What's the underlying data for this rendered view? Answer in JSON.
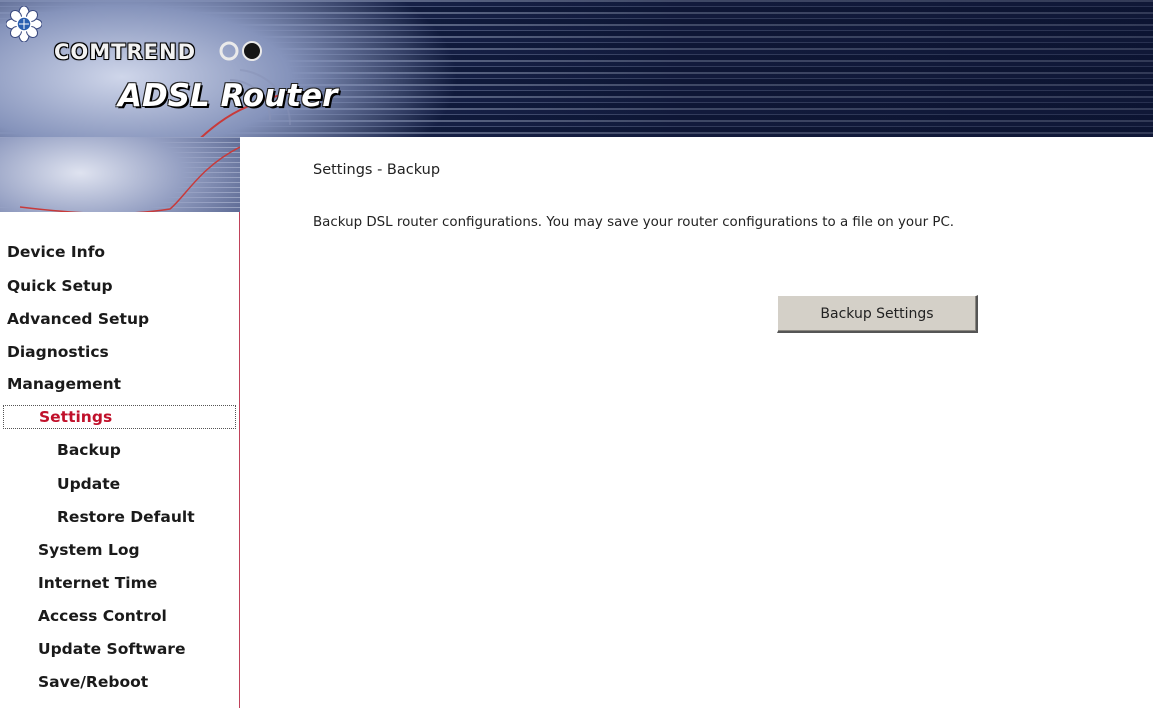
{
  "header": {
    "brand": "COMTREND",
    "product": "ADSL Router"
  },
  "sidebar": {
    "items": [
      {
        "label": "Device Info"
      },
      {
        "label": "Quick Setup"
      },
      {
        "label": "Advanced Setup"
      },
      {
        "label": "Diagnostics"
      },
      {
        "label": "Management"
      },
      {
        "label": "Settings",
        "active": true
      },
      {
        "label": "Backup"
      },
      {
        "label": "Update"
      },
      {
        "label": "Restore Default"
      },
      {
        "label": "System Log"
      },
      {
        "label": "Internet Time"
      },
      {
        "label": "Access Control"
      },
      {
        "label": "Update Software"
      },
      {
        "label": "Save/Reboot"
      }
    ]
  },
  "main": {
    "title": "Settings - Backup",
    "description": "Backup DSL router configurations. You may save your router configurations to a file on your PC.",
    "backup_button": "Backup Settings"
  },
  "colors": {
    "active_nav": "#c0102a",
    "sidebar_border": "#c0425a",
    "button_face": "#d4d0c8"
  }
}
